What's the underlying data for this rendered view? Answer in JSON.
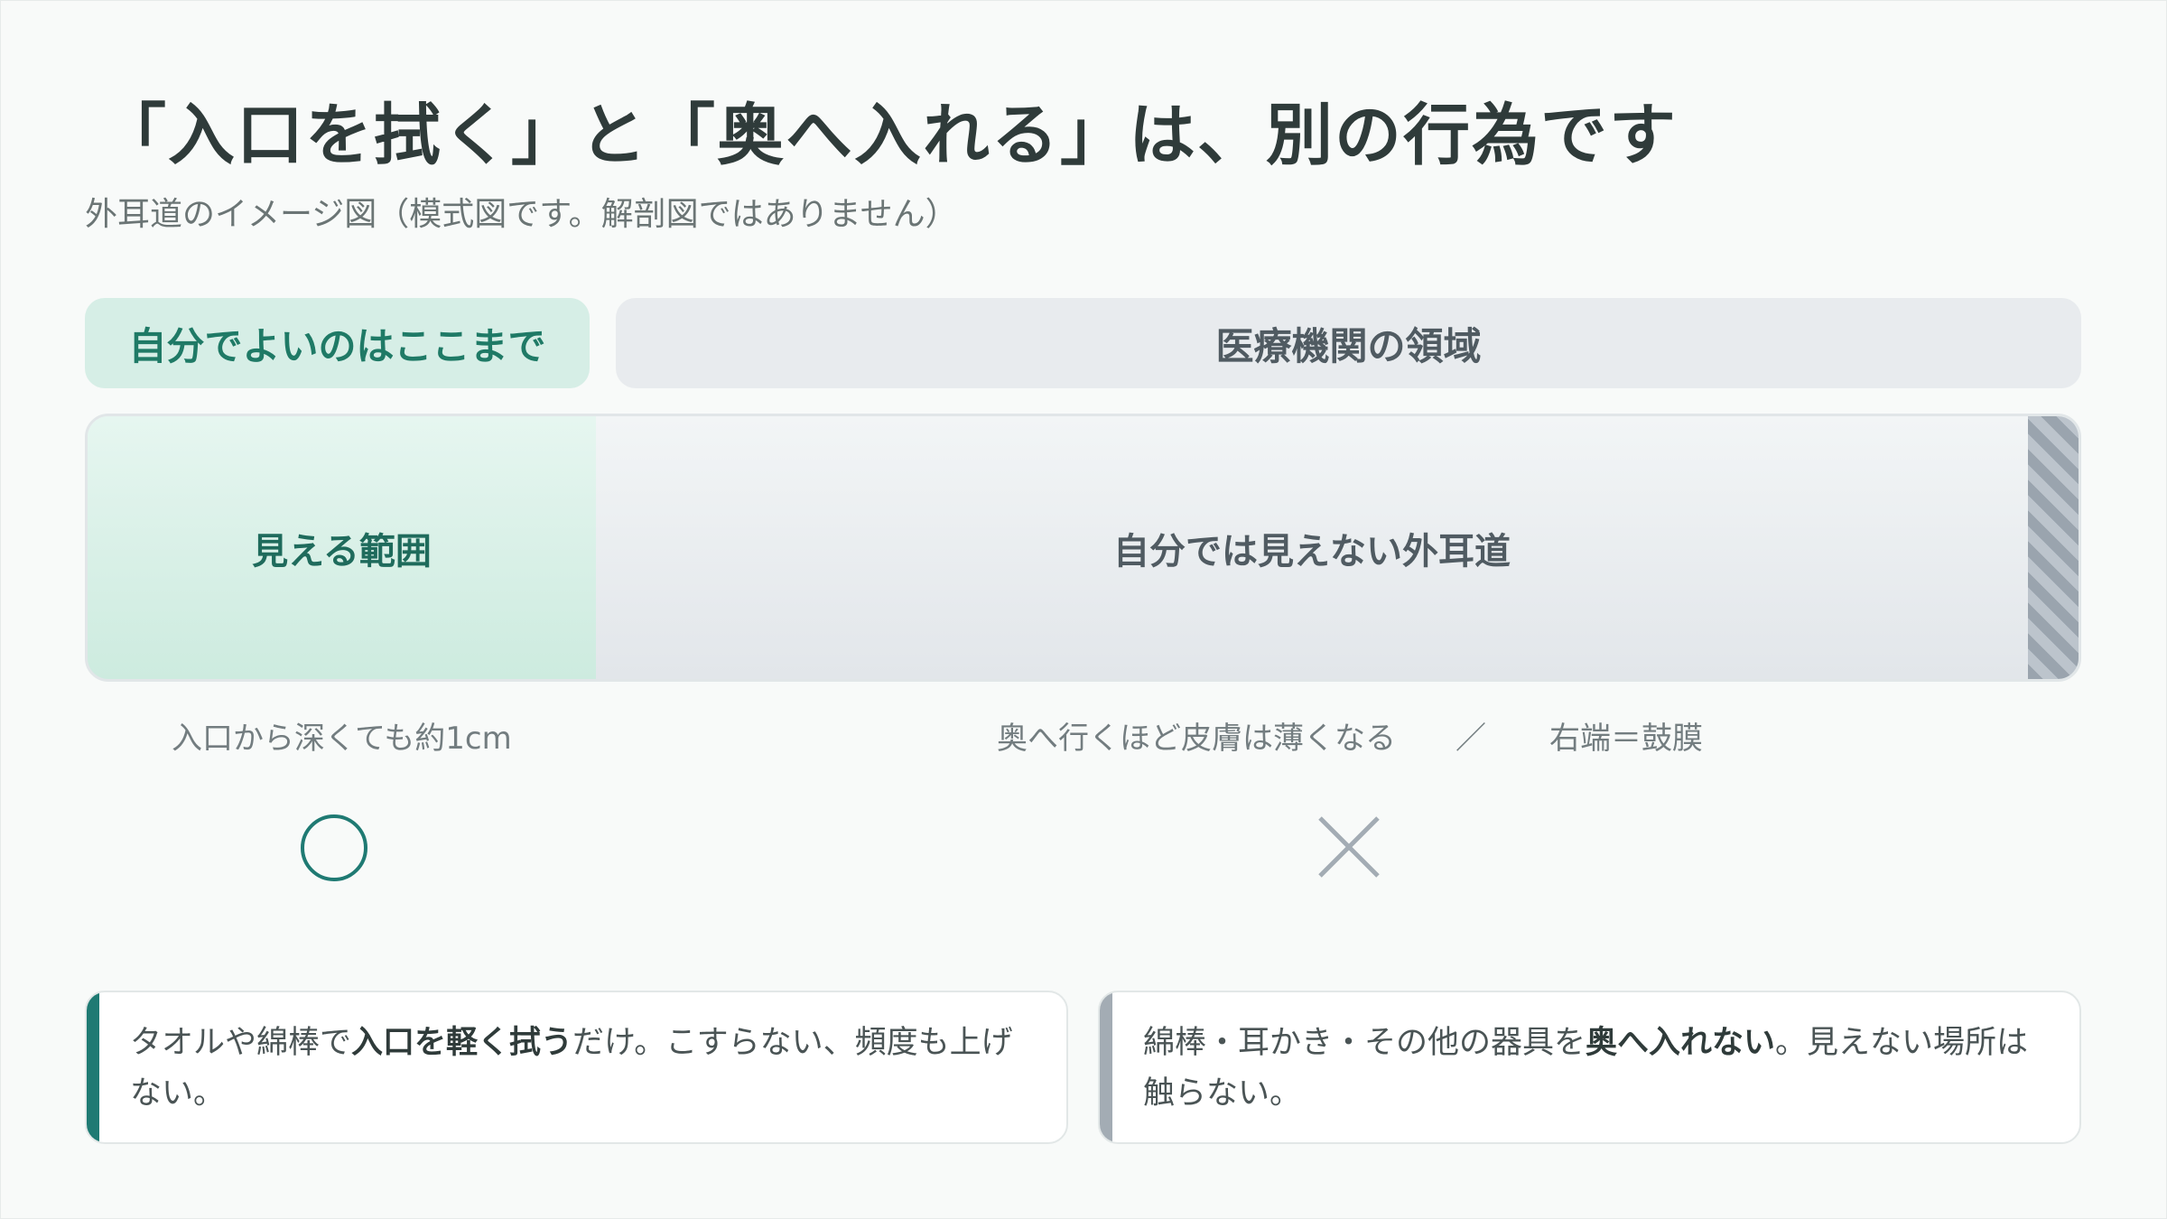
{
  "title": "「入口を拭く」と「奥へ入れる」は、別の行為です",
  "subtitle": "外耳道のイメージ図（模式図です。解剖図ではありません）",
  "tabs": {
    "self": "自分でよいのはここまで",
    "clinic": "医療機関の領域"
  },
  "diagram": {
    "visible_zone": "見える範囲",
    "hidden_zone": "自分では見えない外耳道"
  },
  "notes": {
    "left": "入口から深くても約1cm",
    "middle": "奥へ行くほど皮膚は薄くなる",
    "separator": "／",
    "right": "右端＝鼓膜"
  },
  "marks": {
    "ok": "circle-mark",
    "ng": "cross-mark"
  },
  "cards": {
    "ok": {
      "pre": "タオルや綿棒で",
      "bold": "入口を軽く拭う",
      "post": "だけ。こすらない、頻度も上げない。"
    },
    "ng": {
      "pre": "綿棒・耳かき・その他の器具を",
      "bold": "奥へ入れない",
      "post": "。見えない場所は触らない。"
    }
  },
  "colors": {
    "accent_green": "#1f7a73",
    "tab_green_bg": "#d6eee6",
    "neutral_gray": "#9aa4ae"
  }
}
